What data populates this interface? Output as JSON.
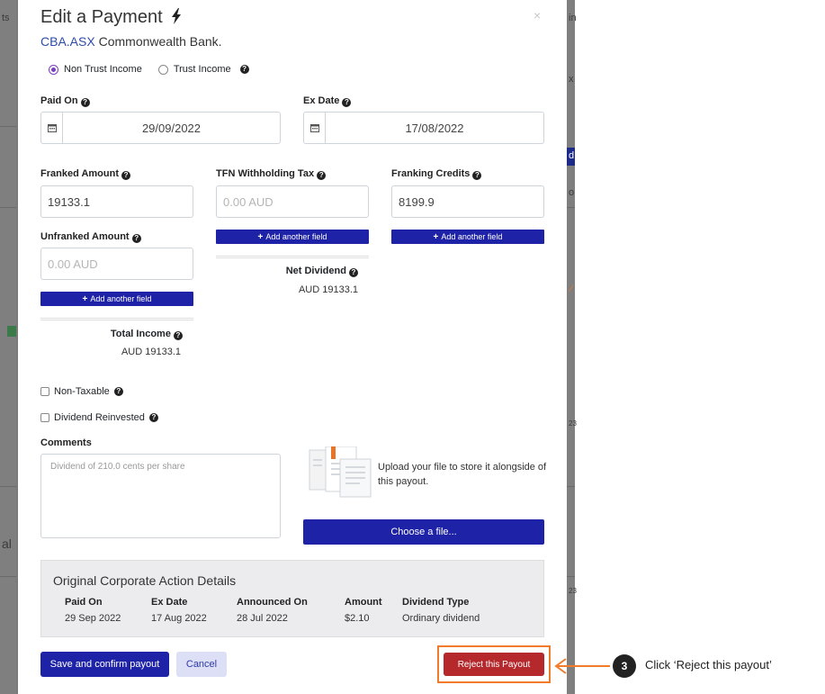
{
  "backdrop": {
    "fragments": [
      "ts",
      "in",
      "x",
      "d",
      "o",
      "23",
      "al",
      "23"
    ]
  },
  "modal": {
    "title": "Edit a Payment",
    "ticker": "CBA.ASX",
    "company": "Commonwealth Bank.",
    "close": "×",
    "radio": {
      "non_trust": "Non Trust Income",
      "trust": "Trust Income",
      "selected": "Non Trust Income"
    },
    "paid_on": {
      "label": "Paid On",
      "value": "29/09/2022"
    },
    "ex_date": {
      "label": "Ex Date",
      "value": "17/08/2022"
    },
    "franked": {
      "label": "Franked Amount",
      "value": "19133.1"
    },
    "tfn": {
      "label": "TFN Withholding Tax",
      "placeholder": "0.00 AUD"
    },
    "franking_credits": {
      "label": "Franking Credits",
      "value": "8199.9"
    },
    "unfranked": {
      "label": "Unfranked Amount",
      "placeholder": "0.00 AUD"
    },
    "add_field": "Add another field",
    "net_dividend": {
      "label": "Net Dividend",
      "value": "AUD 19133.1"
    },
    "total_income": {
      "label": "Total Income",
      "value": "AUD 19133.1"
    },
    "non_taxable": "Non-Taxable",
    "dividend_reinvested": "Dividend Reinvested",
    "comments": {
      "label": "Comments",
      "value": "Dividend of 210.0 cents per share"
    },
    "upload_text": "Upload your file to store it alongside of this payout.",
    "choose_file": "Choose a file...",
    "original": {
      "title": "Original Corporate Action Details",
      "headers": [
        "Paid On",
        "Ex Date",
        "Announced On",
        "Amount",
        "Dividend Type"
      ],
      "row": [
        "29 Sep 2022",
        "17 Aug 2022",
        "28 Jul 2022",
        "$2.10",
        "Ordinary dividend"
      ]
    },
    "save_button": "Save and confirm payout",
    "cancel_button": "Cancel",
    "reject_button": "Reject this Payout"
  },
  "callout": {
    "step": "3",
    "text": "Click ‘Reject this payout’"
  },
  "colors": {
    "primary": "#1e22a6",
    "danger": "#b5292d",
    "highlight": "#f07c2a"
  }
}
